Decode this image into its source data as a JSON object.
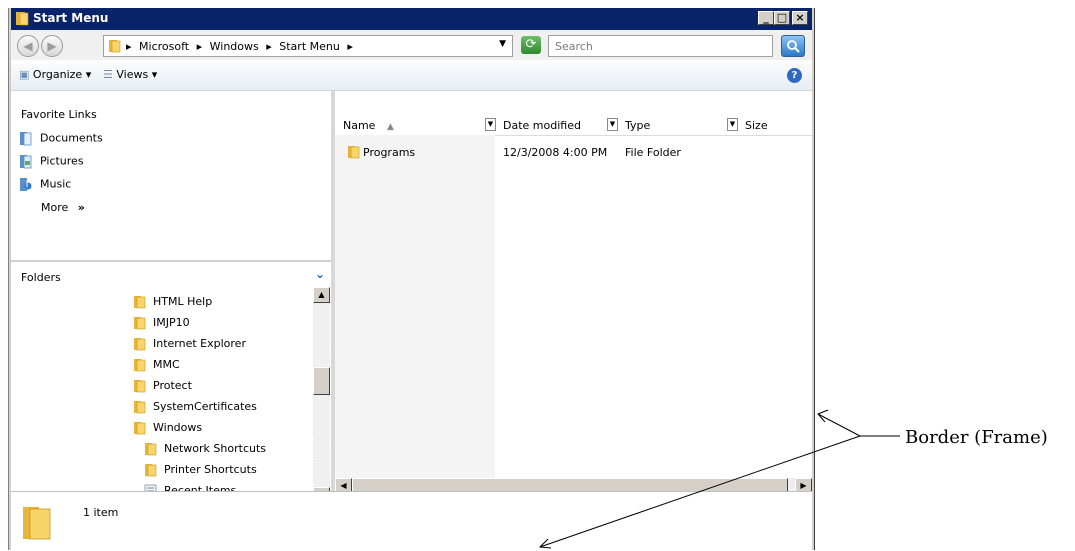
{
  "window": {
    "title": "Start Menu",
    "controls": [
      "_",
      "□",
      "×"
    ]
  },
  "address_bar": {
    "crumbs": [
      "Microsoft",
      "Windows",
      "Start Menu"
    ],
    "search_placeholder": "Search"
  },
  "toolbar": {
    "organize_label": "Organize",
    "views_label": "Views"
  },
  "nav": {
    "favorite_links_title": "Favorite Links",
    "favorites": [
      "Documents",
      "Pictures",
      "Music"
    ],
    "more_label": "More",
    "more_glyph": "»",
    "folders_title": "Folders",
    "tree": [
      "HTML Help",
      "IMJP10",
      "Internet Explorer",
      "MMC",
      "Protect",
      "SystemCertificates",
      "Windows",
      "Network Shortcuts",
      "Printer Shortcuts",
      "Recent Items"
    ]
  },
  "file_list": {
    "columns": [
      "Name",
      "Date modified",
      "Type",
      "Size"
    ],
    "rows": [
      {
        "name": "Programs",
        "date_modified": "12/3/2008 4:00 PM",
        "type": "File Folder",
        "size": ""
      }
    ]
  },
  "status": {
    "item_count": "1 item"
  },
  "annotation": {
    "label": "Border (Frame)"
  },
  "colors": {
    "title_bar": "#0a246a",
    "folder_icon": "#f0c040",
    "frame": "#d4d0c8"
  }
}
